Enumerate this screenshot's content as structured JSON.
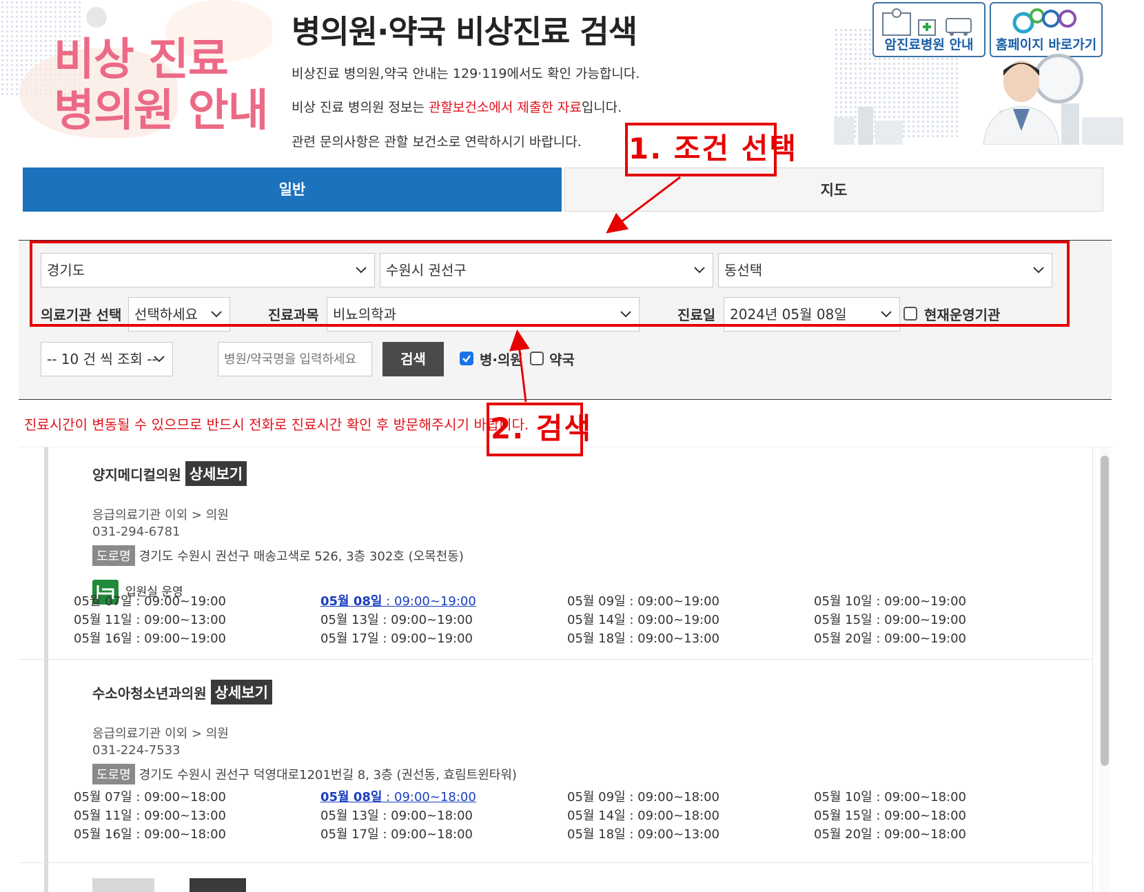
{
  "header": {
    "banner_line1": "비상 진료",
    "banner_line2": "병의원 안내",
    "title": "병의원·약국 비상진료 검색",
    "info1": "비상진료 병의원,약국 안내는 129·119에서도 확인 가능합니다.",
    "info2_pre": "비상 진료 병의원 정보는 ",
    "info2_red": "관할보건소에서 제출한 자료",
    "info2_post": "입니다.",
    "info3": "관련 문의사항은 관할 보건소로 연락하시기 바랍니다.",
    "quick_cancer": "암진료병원 안내",
    "quick_home": "홈페이지 바로가기"
  },
  "tabs": {
    "general": "일반",
    "map": "지도"
  },
  "search": {
    "province": "경기도",
    "city": "수원시 권선구",
    "dong": "동선택",
    "facility_label": "의료기관 선택",
    "facility_value": "선택하세요",
    "dept_label": "진료과목",
    "dept_value": "비뇨의학과",
    "date_label": "진료일",
    "date_value": "2024년 05월 08일",
    "open_now_label": "현재운영기관",
    "page_size": "-- 10 건 씩 조회 --",
    "name_placeholder": "병원/약국명을 입력하세요",
    "search_button": "검색",
    "hospital_label": "병·의원",
    "pharmacy_label": "약국",
    "hospital_checked": true,
    "pharmacy_checked": false
  },
  "warning": "진료시간이 변동될 수 있으므로 반드시 전화로 진료시간 확인 후 방문해주시기 바랍니다.",
  "annotations": {
    "step1": "1. 조건 선택",
    "step2": "2. 검색"
  },
  "colors": {
    "accent": "#1c72bd",
    "warning": "#e0121b",
    "annotation": "#e60000",
    "today": "#1b3fbf"
  },
  "results": [
    {
      "name": "양지메디컬의원",
      "detail": "상세보기",
      "category": "응급의료기관 이외 > 의원",
      "phone": "031-294-6781",
      "addr_tag": "도로명",
      "address": "경기도 수원시 권선구 매송고색로 526, 3층 302호 (오목천동)",
      "inpatient": "입원실 운영",
      "schedule": [
        "05월 07일 : 09:00~19:00",
        "05월 08일 : 09:00~19:00",
        "05월 09일 : 09:00~19:00",
        "05월 10일 : 09:00~19:00",
        "05월 11일 : 09:00~13:00",
        "05월 13일 : 09:00~19:00",
        "05월 14일 : 09:00~19:00",
        "05월 15일 : 09:00~19:00",
        "05월 16일 : 09:00~19:00",
        "05월 17일 : 09:00~19:00",
        "05월 18일 : 09:00~13:00",
        "05월 20일 : 09:00~19:00"
      ]
    },
    {
      "name": "수소아청소년과의원",
      "detail": "상세보기",
      "category": "응급의료기관 이외 > 의원",
      "phone": "031-224-7533",
      "addr_tag": "도로명",
      "address": "경기도 수원시 권선구 덕영대로1201번길 8, 3층 (권선동, 효림트윈타워)",
      "schedule": [
        "05월 07일 : 09:00~18:00",
        "05월 08일 : 09:00~18:00",
        "05월 09일 : 09:00~18:00",
        "05월 10일 : 09:00~18:00",
        "05월 11일 : 09:00~13:00",
        "05월 13일 : 09:00~18:00",
        "05월 14일 : 09:00~18:00",
        "05월 15일 : 09:00~18:00",
        "05월 16일 : 09:00~18:00",
        "05월 17일 : 09:00~18:00",
        "05월 18일 : 09:00~13:00",
        "05월 20일 : 09:00~18:00"
      ]
    }
  ]
}
